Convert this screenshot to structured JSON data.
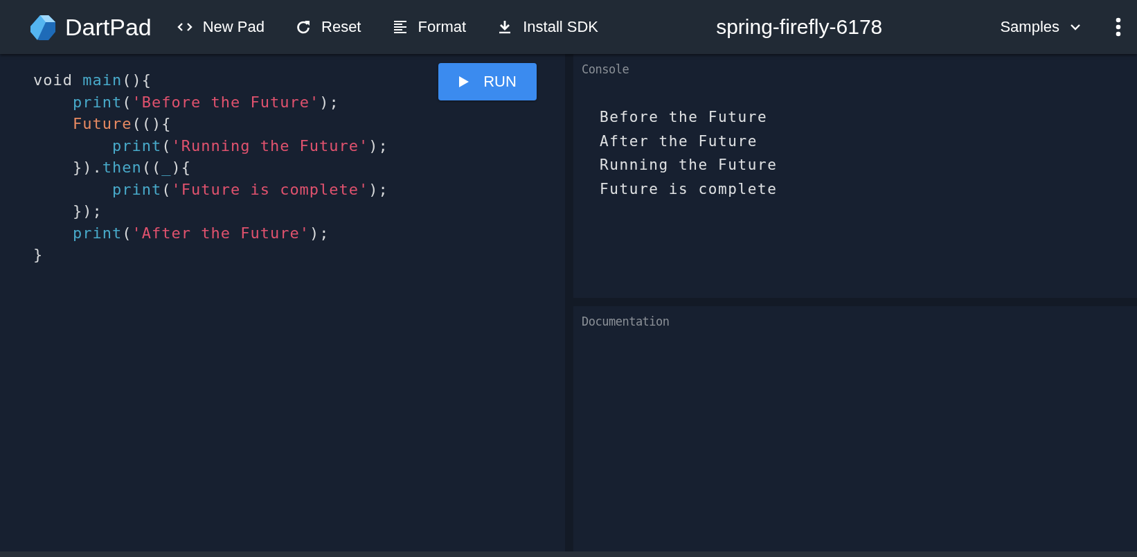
{
  "app": {
    "name": "DartPad"
  },
  "toolbar": [
    {
      "kind": "code",
      "label": "New Pad"
    },
    {
      "kind": "reset",
      "label": "Reset"
    },
    {
      "kind": "format",
      "label": "Format"
    },
    {
      "kind": "download",
      "label": "Install SDK"
    }
  ],
  "pad_title": "spring-firefly-6178",
  "samples": {
    "label": "Samples"
  },
  "run_button": {
    "label": "RUN"
  },
  "code": [
    [
      {
        "kind": "plain",
        "text": "void "
      },
      {
        "kind": "fn",
        "text": "main"
      },
      {
        "kind": "plain",
        "text": "(){"
      }
    ],
    [
      {
        "kind": "fn",
        "text": "    print"
      },
      {
        "kind": "plain",
        "text": "("
      },
      {
        "kind": "string",
        "text": "'Before the Future'"
      },
      {
        "kind": "plain",
        "text": ");"
      }
    ],
    [
      {
        "kind": "type",
        "text": "    Future"
      },
      {
        "kind": "plain",
        "text": "((){"
      }
    ],
    [
      {
        "kind": "fn",
        "text": "        print"
      },
      {
        "kind": "plain",
        "text": "("
      },
      {
        "kind": "string",
        "text": "'Running the Future'"
      },
      {
        "kind": "plain",
        "text": ");"
      }
    ],
    [
      {
        "kind": "plain",
        "text": "    })."
      },
      {
        "kind": "fn",
        "text": "then"
      },
      {
        "kind": "plain",
        "text": "(("
      },
      {
        "kind": "fn",
        "text": "_"
      },
      {
        "kind": "plain",
        "text": "){"
      }
    ],
    [
      {
        "kind": "fn",
        "text": "        print"
      },
      {
        "kind": "plain",
        "text": "("
      },
      {
        "kind": "string",
        "text": "'Future is complete'"
      },
      {
        "kind": "plain",
        "text": ");"
      }
    ],
    [
      {
        "kind": "plain",
        "text": "    });"
      }
    ],
    [
      {
        "kind": "fn",
        "text": "    print"
      },
      {
        "kind": "plain",
        "text": "("
      },
      {
        "kind": "string",
        "text": "'After the Future'"
      },
      {
        "kind": "plain",
        "text": ");"
      }
    ],
    [
      {
        "kind": "plain",
        "text": "}"
      }
    ]
  ],
  "console": {
    "title": "Console",
    "lines": [
      "Before the Future",
      "After the Future",
      "Running the Future",
      "Future is complete"
    ]
  },
  "documentation": {
    "title": "Documentation"
  }
}
